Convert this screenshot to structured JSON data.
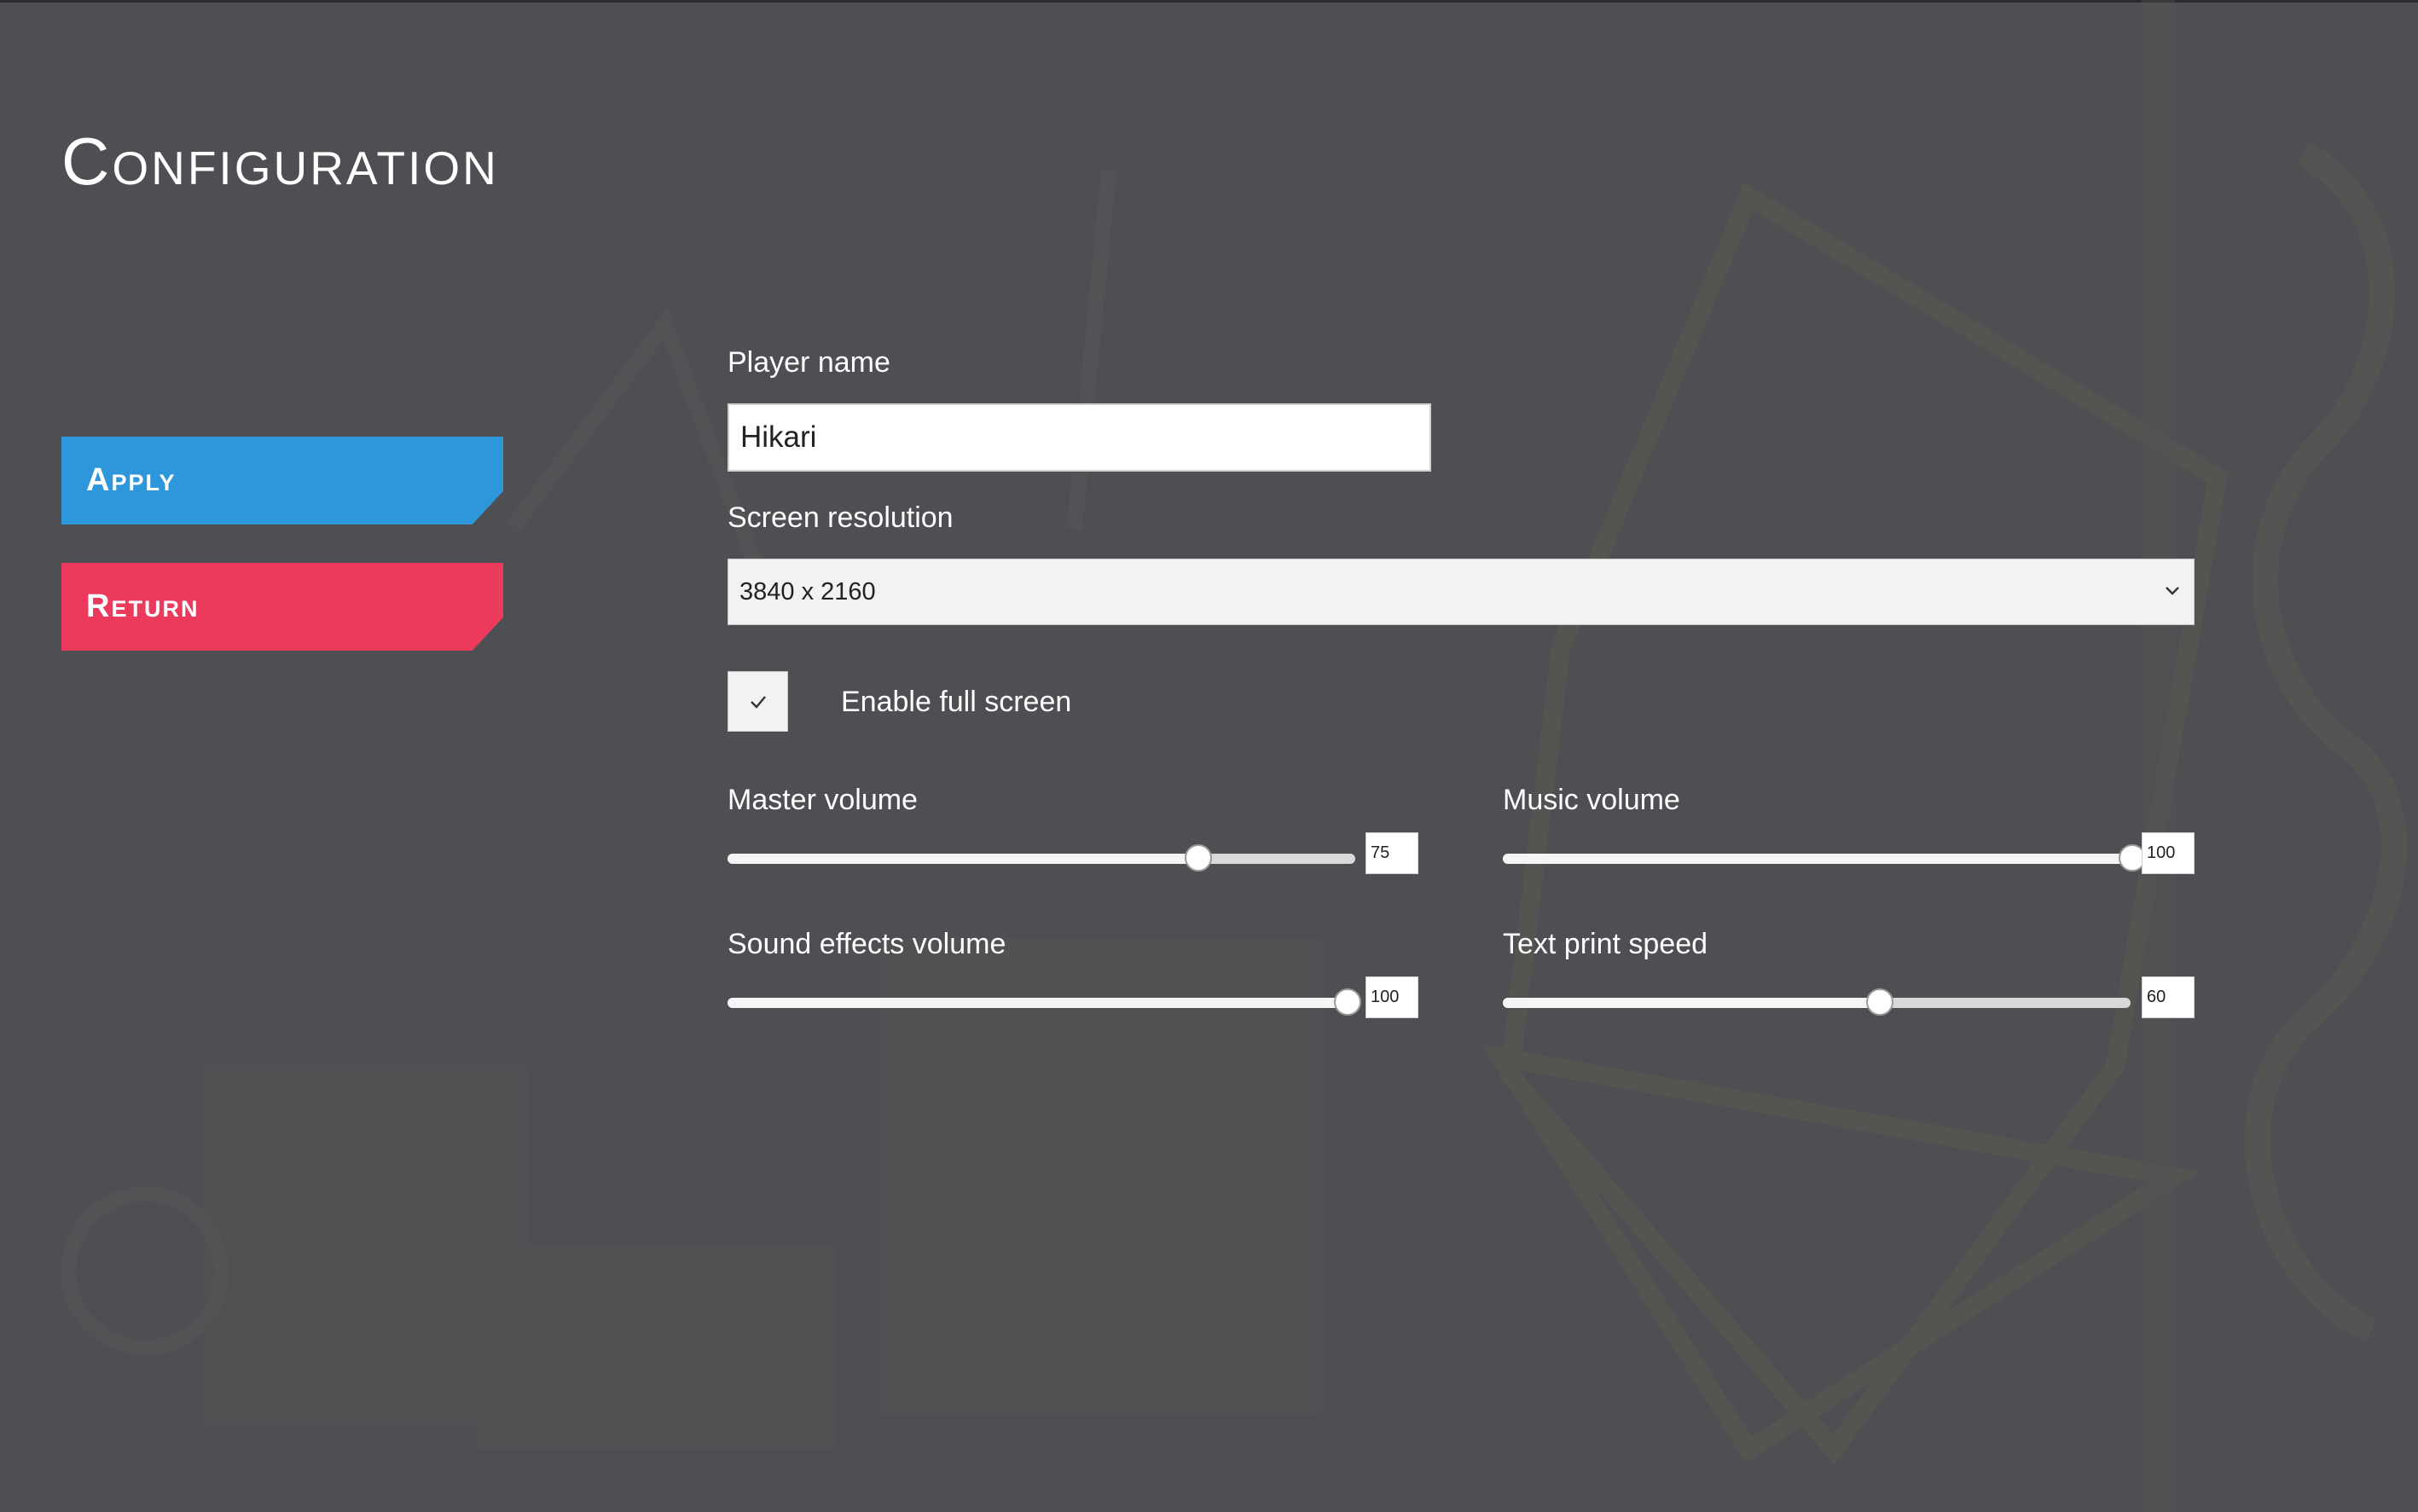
{
  "page": {
    "title": "Configuration"
  },
  "sidebar": {
    "apply_label": "Apply",
    "return_label": "Return"
  },
  "form": {
    "player_name": {
      "label": "Player name",
      "value": "Hikari"
    },
    "resolution": {
      "label": "Screen resolution",
      "selected": "3840 x 2160"
    },
    "fullscreen": {
      "label": "Enable full screen",
      "checked": true
    },
    "master_volume": {
      "label": "Master volume",
      "value": "75",
      "max": 100
    },
    "music_volume": {
      "label": "Music volume",
      "value": "100",
      "max": 100
    },
    "sfx_volume": {
      "label": "Sound effects volume",
      "value": "100",
      "max": 100
    },
    "text_speed": {
      "label": "Text print speed",
      "value": "60",
      "max": 100
    }
  },
  "colors": {
    "background": "#4e4f53",
    "apply": "#2e97db",
    "return": "#ec3a5c"
  },
  "icons": {
    "select_arrow": "chevron-down-icon",
    "checkbox_mark": "checkmark-icon"
  }
}
